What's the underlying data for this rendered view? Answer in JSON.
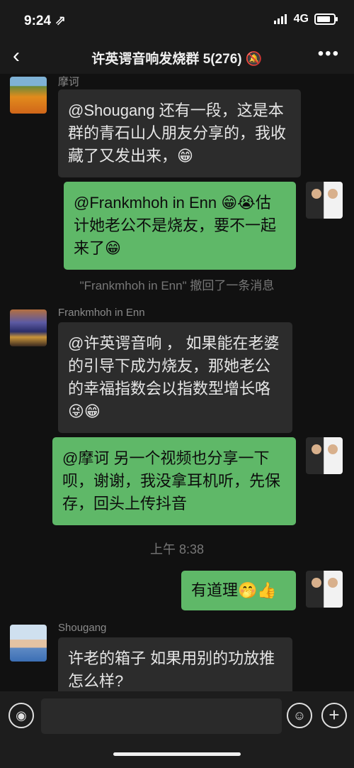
{
  "status_bar": {
    "time": "9:24 ⇗",
    "network": "4G"
  },
  "nav": {
    "back": "‹",
    "title": "许英谔音响发烧群 5(276) 🔕",
    "more": "•••"
  },
  "messages": [
    {
      "type": "in",
      "sender": "摩诃",
      "avatar": "flower-avatar",
      "text": "@Shougang 还有一段，这是本群的青石山人朋友分享的，我收藏了又发出来，😁"
    },
    {
      "type": "out",
      "avatar": "self-avatar",
      "text": "@Frankmhoh in Enn 😁😭估计她老公不是烧友，要不一起来了😁"
    },
    {
      "type": "system",
      "text": "\"Frankmhoh in Enn\" 撤回了一条消息"
    },
    {
      "type": "in",
      "sender": "Frankmhoh in Enn",
      "avatar": "town-avatar",
      "text": "@许英谔音响 ， 如果能在老婆的引导下成为烧友，那她老公的幸福指数会以指数型增长咯😜😁"
    },
    {
      "type": "out",
      "avatar": "self-avatar",
      "text": "@摩诃 另一个视频也分享一下呗，谢谢，我没拿耳机听，先保存，回头上传抖音"
    },
    {
      "type": "time",
      "text": "上午 8:38"
    },
    {
      "type": "out",
      "avatar": "self-avatar",
      "text": "有道理🤭👍"
    },
    {
      "type": "in",
      "sender": "Shougang",
      "avatar": "man-avatar",
      "text": "许老的箱子 如果用别的功放推 怎么样?"
    }
  ],
  "input_bar": {
    "voice_icon": "voice-icon",
    "emoji_icon": "emoji-icon",
    "plus_icon": "plus-icon",
    "voice_glyph": "◉",
    "emoji_glyph": "☺",
    "plus_glyph": "+"
  }
}
